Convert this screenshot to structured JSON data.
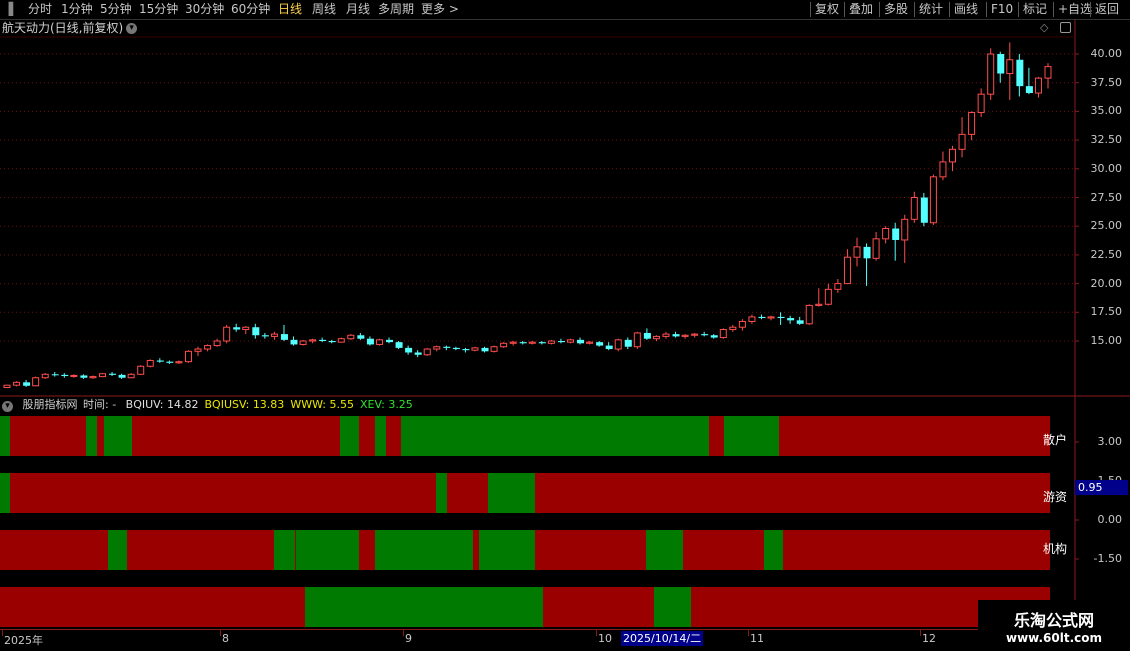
{
  "toolbar": {
    "left_items": [
      "分时",
      "1分钟",
      "5分钟",
      "15分钟",
      "30分钟",
      "60分钟",
      "日线",
      "周线",
      "月线",
      "多周期",
      "更多 >"
    ],
    "active": "日线",
    "right_items": [
      "复权",
      "叠加",
      "多股",
      "统计",
      "画线",
      "F10",
      "标记",
      "+自选",
      "返回"
    ]
  },
  "chart_title": "航天动力(日线,前复权)",
  "price_axis": {
    "labels": [
      "40.00",
      "37.50",
      "35.00",
      "32.50",
      "30.00",
      "27.50",
      "25.00",
      "22.50",
      "20.00",
      "17.50",
      "15.00"
    ],
    "values": [
      40,
      37.5,
      35,
      32.5,
      30,
      27.5,
      25,
      22.5,
      20,
      17.5,
      15
    ]
  },
  "indicator": {
    "name": "股朋指标网",
    "time_label": "时间: -",
    "values": [
      {
        "text": "BQIUV: 14.82",
        "color": "#e0e0e0"
      },
      {
        "text": "BQIUSV: 13.83",
        "color": "#e8e800"
      },
      {
        "text": "WWW: 5.55",
        "color": "#e8e800"
      },
      {
        "text": "XEV: 3.25",
        "color": "#30e030"
      }
    ],
    "axis_labels": [
      "3.00",
      "1.50",
      "0.00",
      "-1.50"
    ],
    "axis_values": [
      3,
      1.5,
      0,
      -1.5
    ],
    "current_value": "0.95",
    "rows": [
      {
        "name": "散户",
        "segments": [
          [
            "g",
            0,
            10
          ],
          [
            "r",
            10,
            86
          ],
          [
            "g",
            86,
            97
          ],
          [
            "r",
            97,
            104
          ],
          [
            "g",
            104,
            132
          ],
          [
            "r",
            132,
            340
          ],
          [
            "g",
            340,
            359
          ],
          [
            "r",
            359,
            375
          ],
          [
            "g",
            375,
            386
          ],
          [
            "r",
            386,
            401
          ],
          [
            "g",
            401,
            709
          ],
          [
            "r",
            709,
            724
          ],
          [
            "g",
            724,
            779
          ],
          [
            "r",
            779,
            1050
          ]
        ]
      },
      {
        "name": "游资",
        "segments": [
          [
            "g",
            0,
            10
          ],
          [
            "r",
            10,
            436
          ],
          [
            "g",
            436,
            447
          ],
          [
            "r",
            447,
            488
          ],
          [
            "g",
            488,
            535
          ],
          [
            "r",
            535,
            1050
          ]
        ]
      },
      {
        "name": "机构",
        "segments": [
          [
            "r",
            0,
            108
          ],
          [
            "g",
            108,
            127
          ],
          [
            "r",
            127,
            274
          ],
          [
            "g",
            274,
            295
          ],
          [
            "r",
            295,
            296
          ],
          [
            "g",
            296,
            359
          ],
          [
            "r",
            359,
            375
          ],
          [
            "g",
            375,
            473
          ],
          [
            "r",
            473,
            479
          ],
          [
            "g",
            479,
            535
          ],
          [
            "r",
            535,
            646
          ],
          [
            "g",
            646,
            683
          ],
          [
            "r",
            683,
            764
          ],
          [
            "g",
            764,
            783
          ],
          [
            "r",
            783,
            1050
          ]
        ]
      },
      {
        "name": "",
        "segments": [
          [
            "r",
            0,
            305
          ],
          [
            "g",
            305,
            543
          ],
          [
            "r",
            543,
            654
          ],
          [
            "g",
            654,
            691
          ],
          [
            "r",
            691,
            1050
          ]
        ]
      }
    ]
  },
  "time_axis": {
    "labels": [
      "2025年",
      "8",
      "9",
      "10",
      "11",
      "12"
    ],
    "highlight": "2025/10/14/二"
  },
  "watermark": {
    "line1": "乐淘公式网",
    "line2": "www.60lt.com"
  },
  "colors": {
    "up": "#ff4d4d",
    "down": "#54ffff",
    "bar_red": "#9b0000",
    "bar_green": "#007a00",
    "grid": "#8a1a1a"
  },
  "candles": [
    [
      10.95,
      11.2,
      10.9,
      11.15
    ],
    [
      11.15,
      11.5,
      11.05,
      11.4
    ],
    [
      11.4,
      11.6,
      11.0,
      11.1
    ],
    [
      11.1,
      11.9,
      11.05,
      11.8
    ],
    [
      11.8,
      12.2,
      11.7,
      12.1
    ],
    [
      12.1,
      12.3,
      11.9,
      12.05
    ],
    [
      12.05,
      12.2,
      11.8,
      11.95
    ],
    [
      11.95,
      12.1,
      11.8,
      12.0
    ],
    [
      12.0,
      12.1,
      11.7,
      11.8
    ],
    [
      11.8,
      12.0,
      11.7,
      11.9
    ],
    [
      11.9,
      12.2,
      11.85,
      12.15
    ],
    [
      12.15,
      12.3,
      11.95,
      12.05
    ],
    [
      12.05,
      12.15,
      11.7,
      11.8
    ],
    [
      11.8,
      12.2,
      11.75,
      12.1
    ],
    [
      12.1,
      12.9,
      12.05,
      12.8
    ],
    [
      12.8,
      13.4,
      12.7,
      13.3
    ],
    [
      13.3,
      13.5,
      13.1,
      13.2
    ],
    [
      13.2,
      13.3,
      13.0,
      13.1
    ],
    [
      13.1,
      13.3,
      13.0,
      13.2
    ],
    [
      13.2,
      14.2,
      13.1,
      14.1
    ],
    [
      14.1,
      14.5,
      13.7,
      14.3
    ],
    [
      14.3,
      14.7,
      14.1,
      14.6
    ],
    [
      14.6,
      15.2,
      14.5,
      15.0
    ],
    [
      15.0,
      16.4,
      14.8,
      16.2
    ],
    [
      16.2,
      16.5,
      15.8,
      16.0
    ],
    [
      16.0,
      16.3,
      15.6,
      16.2
    ],
    [
      16.2,
      16.5,
      15.2,
      15.5
    ],
    [
      15.5,
      15.7,
      15.2,
      15.4
    ],
    [
      15.4,
      15.8,
      15.1,
      15.6
    ],
    [
      15.6,
      16.4,
      15.0,
      15.1
    ],
    [
      15.1,
      15.4,
      14.6,
      14.7
    ],
    [
      14.7,
      15.1,
      14.6,
      15.0
    ],
    [
      15.0,
      15.2,
      14.8,
      15.1
    ],
    [
      15.1,
      15.3,
      14.9,
      15.0
    ],
    [
      15.0,
      15.1,
      14.8,
      14.9
    ],
    [
      14.9,
      15.3,
      14.85,
      15.2
    ],
    [
      15.2,
      15.6,
      15.1,
      15.5
    ],
    [
      15.5,
      15.7,
      15.1,
      15.2
    ],
    [
      15.2,
      15.4,
      14.6,
      14.7
    ],
    [
      14.7,
      15.2,
      14.6,
      15.1
    ],
    [
      15.1,
      15.3,
      14.8,
      14.9
    ],
    [
      14.9,
      15.0,
      14.3,
      14.4
    ],
    [
      14.4,
      14.6,
      13.8,
      14.0
    ],
    [
      14.0,
      14.2,
      13.6,
      13.8
    ],
    [
      13.8,
      14.4,
      13.7,
      14.3
    ],
    [
      14.3,
      14.6,
      14.1,
      14.5
    ],
    [
      14.5,
      14.6,
      14.2,
      14.4
    ],
    [
      14.4,
      14.5,
      14.2,
      14.3
    ],
    [
      14.3,
      14.4,
      14.0,
      14.2
    ],
    [
      14.2,
      14.5,
      14.1,
      14.4
    ],
    [
      14.4,
      14.5,
      14.0,
      14.1
    ],
    [
      14.1,
      14.6,
      14.0,
      14.5
    ],
    [
      14.5,
      14.9,
      14.4,
      14.8
    ],
    [
      14.8,
      15.0,
      14.6,
      14.9
    ],
    [
      14.9,
      15.0,
      14.7,
      14.8
    ],
    [
      14.8,
      15.0,
      14.7,
      14.9
    ],
    [
      14.9,
      15.0,
      14.7,
      14.8
    ],
    [
      14.8,
      15.1,
      14.7,
      15.0
    ],
    [
      15.0,
      15.2,
      14.8,
      14.9
    ],
    [
      14.9,
      15.2,
      14.8,
      15.1
    ],
    [
      15.1,
      15.3,
      14.7,
      14.8
    ],
    [
      14.8,
      15.0,
      14.7,
      14.9
    ],
    [
      14.9,
      15.0,
      14.5,
      14.6
    ],
    [
      14.6,
      14.9,
      14.2,
      14.3
    ],
    [
      14.3,
      15.2,
      14.1,
      15.1
    ],
    [
      15.1,
      15.3,
      14.3,
      14.5
    ],
    [
      14.5,
      15.8,
      14.3,
      15.7
    ],
    [
      15.7,
      16.1,
      15.1,
      15.2
    ],
    [
      15.2,
      15.5,
      15.0,
      15.4
    ],
    [
      15.4,
      15.8,
      15.2,
      15.6
    ],
    [
      15.6,
      15.8,
      15.3,
      15.4
    ],
    [
      15.4,
      15.6,
      15.2,
      15.5
    ],
    [
      15.5,
      15.7,
      15.3,
      15.6
    ],
    [
      15.6,
      15.8,
      15.4,
      15.5
    ],
    [
      15.5,
      15.6,
      15.2,
      15.3
    ],
    [
      15.3,
      16.1,
      15.2,
      16.0
    ],
    [
      16.0,
      16.4,
      15.8,
      16.2
    ],
    [
      16.2,
      16.9,
      15.9,
      16.7
    ],
    [
      16.7,
      17.3,
      16.5,
      17.1
    ],
    [
      17.1,
      17.3,
      16.9,
      17.0
    ],
    [
      17.0,
      17.2,
      16.8,
      17.1
    ],
    [
      17.1,
      17.5,
      16.4,
      17.0
    ],
    [
      17.0,
      17.2,
      16.5,
      16.8
    ],
    [
      16.8,
      17.1,
      16.4,
      16.5
    ],
    [
      16.5,
      18.2,
      16.4,
      18.1
    ],
    [
      18.1,
      19.6,
      18.0,
      18.2
    ],
    [
      18.2,
      20.0,
      18.1,
      19.5
    ],
    [
      19.5,
      20.4,
      19.2,
      20.0
    ],
    [
      20.0,
      23.0,
      20.0,
      22.3
    ],
    [
      22.3,
      24.0,
      21.5,
      23.2
    ],
    [
      23.2,
      23.5,
      19.8,
      22.2
    ],
    [
      22.2,
      24.5,
      22.0,
      23.9
    ],
    [
      23.9,
      25.0,
      23.5,
      24.8
    ],
    [
      24.8,
      25.3,
      22.0,
      23.8
    ],
    [
      23.8,
      26.0,
      21.8,
      25.6
    ],
    [
      25.6,
      28.0,
      25.3,
      27.5
    ],
    [
      27.5,
      27.9,
      25.0,
      25.3
    ],
    [
      25.3,
      29.5,
      25.1,
      29.3
    ],
    [
      29.3,
      31.5,
      29.0,
      30.6
    ],
    [
      30.6,
      32.0,
      29.8,
      31.7
    ],
    [
      31.7,
      34.5,
      31.0,
      33.0
    ],
    [
      33.0,
      35.0,
      32.5,
      34.9
    ],
    [
      34.9,
      37.0,
      34.5,
      36.5
    ],
    [
      36.5,
      40.5,
      36.0,
      40.0
    ],
    [
      40.0,
      40.2,
      37.5,
      38.3
    ],
    [
      38.3,
      41.0,
      36.0,
      39.5
    ],
    [
      39.5,
      40.0,
      36.3,
      37.2
    ],
    [
      37.2,
      38.8,
      36.5,
      36.6
    ],
    [
      36.6,
      38.0,
      36.2,
      37.9
    ],
    [
      37.9,
      39.2,
      37.0,
      38.9
    ]
  ]
}
